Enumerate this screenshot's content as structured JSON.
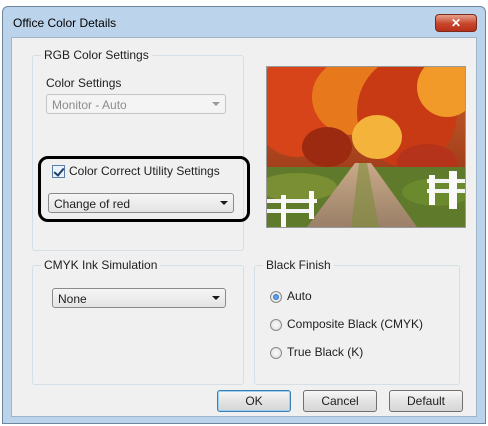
{
  "window": {
    "title": "Office Color Details",
    "close_glyph": "✕"
  },
  "rgb": {
    "legend": "RGB Color Settings",
    "color_settings_label": "Color Settings",
    "color_settings_value": "Monitor - Auto",
    "color_correct_label": "Color Correct Utility Settings",
    "color_correct_checked": true,
    "color_correct_value": "Change of red"
  },
  "preview": {
    "description_icon": "autumn-road-photo"
  },
  "cmyk": {
    "legend": "CMYK Ink Simulation",
    "value": "None"
  },
  "black_finish": {
    "legend": "Black Finish",
    "options": [
      {
        "label": "Auto",
        "checked": true
      },
      {
        "label": "Composite Black (CMYK)",
        "checked": false
      },
      {
        "label": "True Black (K)",
        "checked": false
      }
    ]
  },
  "buttons": {
    "ok": "OK",
    "cancel": "Cancel",
    "default": "Default"
  }
}
